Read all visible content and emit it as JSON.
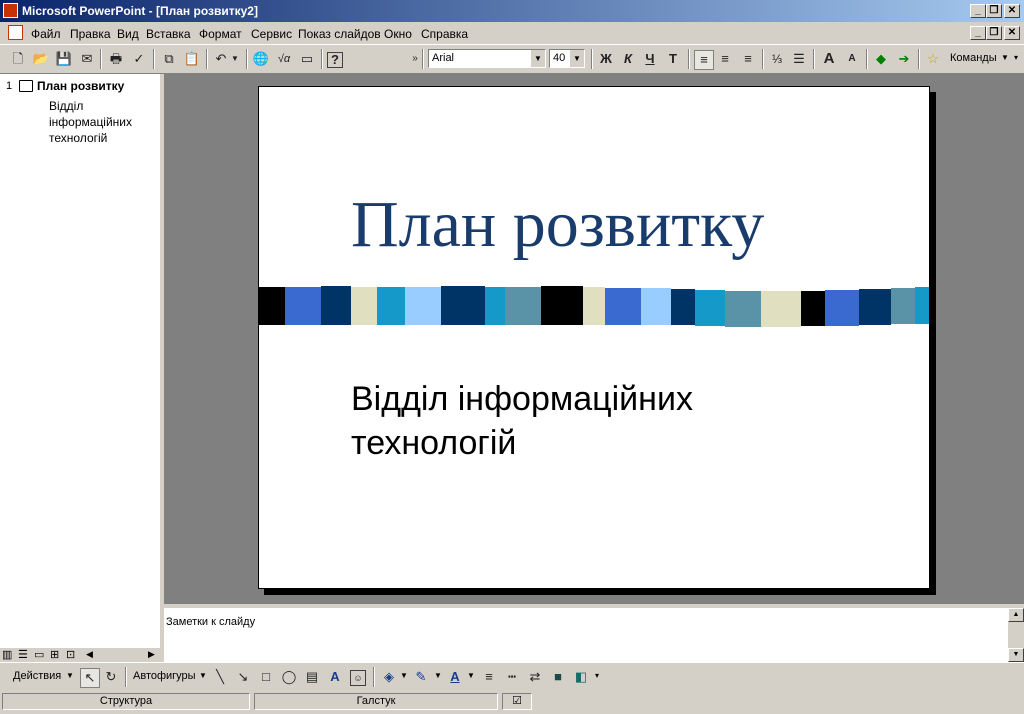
{
  "window": {
    "title": "Microsoft PowerPoint - [План розвитку2]"
  },
  "menu": {
    "items": [
      "Файл",
      "Правка",
      "Вид",
      "Вставка",
      "Формат",
      "Сервис",
      "Показ слайдов",
      "Окно",
      "Справка"
    ]
  },
  "toolbar": {
    "font_name": "Arial",
    "font_size": "40",
    "bold": "Ж",
    "italic": "К",
    "underline": "Ч",
    "commands_label": "Команды"
  },
  "outline": {
    "slide_number": "1",
    "title": "План розвитку",
    "body": "Відділ інформаційних технологій"
  },
  "slide": {
    "title": "План розвитку",
    "body_line1": "Відділ інформаційних",
    "body_line2": "технологій"
  },
  "notes": {
    "placeholder": "Заметки к слайду"
  },
  "drawing": {
    "actions_label": "Действия",
    "autoshapes_label": "Автофигуры"
  },
  "status": {
    "view": "Структура",
    "design": "Галстук"
  },
  "colors": {
    "title_bar": "#0a246a",
    "slide_title": "#1a3c6c",
    "workspace": "#808080"
  }
}
